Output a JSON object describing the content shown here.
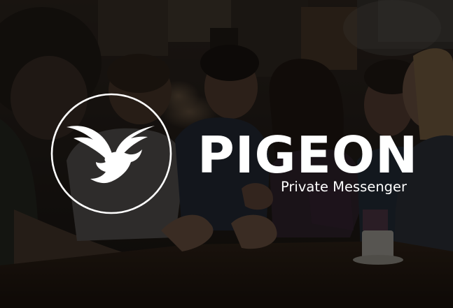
{
  "brand": {
    "name": "PIGEON",
    "tagline": "Private Messenger",
    "logo_icon": "pigeon-bird-in-circle-icon",
    "text_color": "#ffffff"
  },
  "background": {
    "description_icon": "group-of-friends-laughing-at-cafe-photo",
    "overlay_color": "#000000"
  }
}
